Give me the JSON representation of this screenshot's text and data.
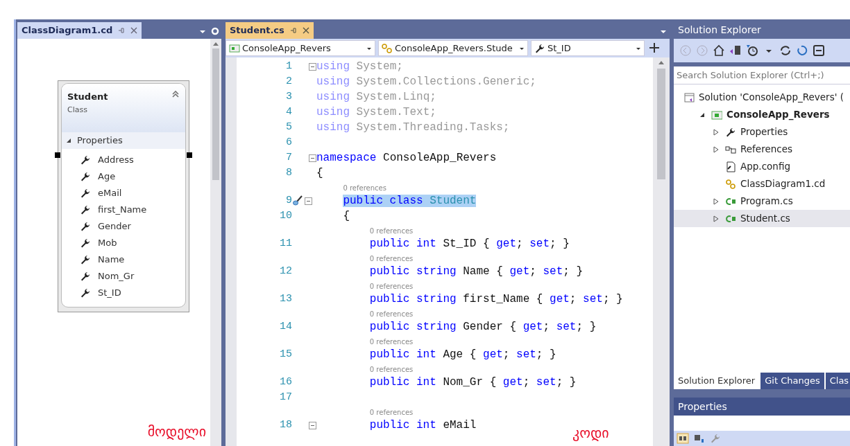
{
  "diagram_panel": {
    "tab": {
      "label": "ClassDiagram1.cd",
      "selected": true
    },
    "class_shape": {
      "name": "Student",
      "kind_label": "Class",
      "selected": true,
      "compartment": {
        "label": "Properties",
        "expanded": true,
        "members": [
          "Address",
          "Age",
          "eMail",
          "first_Name",
          "Gender",
          "Mob",
          "Name",
          "Nom_Gr",
          "St_ID"
        ]
      }
    },
    "annotation": "მოდელი"
  },
  "editor": {
    "tab": {
      "label": "Student.cs",
      "selected": true
    },
    "nav": [
      "ConsoleApp_Revers",
      "ConsoleApp_Revers.Stude",
      "St_ID"
    ],
    "lines": [
      {
        "number": "1",
        "fold": true,
        "highlighted": false,
        "tokens": [
          {
            "t": "using",
            "kind": "dim-keyword"
          },
          {
            "t": " System;",
            "kind": "dim"
          }
        ]
      },
      {
        "number": "2",
        "fold": false,
        "highlighted": false,
        "tokens": [
          {
            "t": "using",
            "kind": "dim-keyword"
          },
          {
            "t": " System.Collections.Generic;",
            "kind": "dim"
          }
        ]
      },
      {
        "number": "3",
        "fold": false,
        "highlighted": false,
        "tokens": [
          {
            "t": "using",
            "kind": "dim-keyword"
          },
          {
            "t": " System.Linq;",
            "kind": "dim"
          }
        ]
      },
      {
        "number": "4",
        "fold": false,
        "highlighted": false,
        "tokens": [
          {
            "t": "using",
            "kind": "dim-keyword"
          },
          {
            "t": " System.Text;",
            "kind": "dim"
          }
        ]
      },
      {
        "number": "5",
        "fold": false,
        "highlighted": false,
        "tokens": [
          {
            "t": "using",
            "kind": "dim-keyword"
          },
          {
            "t": " System.Threading.Tasks;",
            "kind": "dim"
          }
        ]
      },
      {
        "number": "6",
        "fold": false
      },
      {
        "number": "7",
        "fold": true,
        "highlighted": false,
        "tokens": [
          {
            "t": "namespace",
            "kind": "keyword"
          },
          {
            "t": " ConsoleApp_Revers",
            "kind": "plain"
          }
        ]
      },
      {
        "number": "8",
        "fold": false,
        "highlighted": false,
        "tokens": [
          {
            "t": "{",
            "kind": "plain"
          }
        ],
        "children": [
          {
            "number": "9",
            "fold": true,
            "highlighted": true,
            "quick_action": true,
            "references": "0 references",
            "tokens": [
              {
                "t": "public class",
                "kind": "keyword"
              },
              {
                "t": " Student",
                "kind": "type"
              }
            ]
          },
          {
            "number": "10",
            "fold": false,
            "highlighted": false,
            "tokens": [
              {
                "t": "{",
                "kind": "plain"
              }
            ],
            "children": [
              {
                "number": "11",
                "fold": false,
                "highlighted": false,
                "references": "0 references",
                "tokens": [
                  {
                    "t": "public int",
                    "kind": "keyword"
                  },
                  {
                    "t": " St_ID { ",
                    "kind": "plain"
                  },
                  {
                    "t": "get",
                    "kind": "keyword"
                  },
                  {
                    "t": "; ",
                    "kind": "plain"
                  },
                  {
                    "t": "set",
                    "kind": "keyword"
                  },
                  {
                    "t": "; }",
                    "kind": "plain"
                  }
                ]
              },
              {
                "number": "12",
                "fold": false,
                "highlighted": false,
                "references": "0 references",
                "tokens": [
                  {
                    "t": "public string",
                    "kind": "keyword"
                  },
                  {
                    "t": " Name { ",
                    "kind": "plain"
                  },
                  {
                    "t": "get",
                    "kind": "keyword"
                  },
                  {
                    "t": "; ",
                    "kind": "plain"
                  },
                  {
                    "t": "set",
                    "kind": "keyword"
                  },
                  {
                    "t": "; }",
                    "kind": "plain"
                  }
                ]
              },
              {
                "number": "13",
                "fold": false,
                "highlighted": false,
                "references": "0 references",
                "tokens": [
                  {
                    "t": "public string",
                    "kind": "keyword"
                  },
                  {
                    "t": " first_Name { ",
                    "kind": "plain"
                  },
                  {
                    "t": "get",
                    "kind": "keyword"
                  },
                  {
                    "t": "; ",
                    "kind": "plain"
                  },
                  {
                    "t": "set",
                    "kind": "keyword"
                  },
                  {
                    "t": "; }",
                    "kind": "plain"
                  }
                ]
              },
              {
                "number": "14",
                "fold": false,
                "highlighted": false,
                "references": "0 references",
                "tokens": [
                  {
                    "t": "public string",
                    "kind": "keyword"
                  },
                  {
                    "t": " Gender { ",
                    "kind": "plain"
                  },
                  {
                    "t": "get",
                    "kind": "keyword"
                  },
                  {
                    "t": "; ",
                    "kind": "plain"
                  },
                  {
                    "t": "set",
                    "kind": "keyword"
                  },
                  {
                    "t": "; }",
                    "kind": "plain"
                  }
                ]
              },
              {
                "number": "15",
                "fold": false,
                "highlighted": false,
                "references": "0 references",
                "tokens": [
                  {
                    "t": "public int",
                    "kind": "keyword"
                  },
                  {
                    "t": " Age { ",
                    "kind": "plain"
                  },
                  {
                    "t": "get",
                    "kind": "keyword"
                  },
                  {
                    "t": "; ",
                    "kind": "plain"
                  },
                  {
                    "t": "set",
                    "kind": "keyword"
                  },
                  {
                    "t": "; }",
                    "kind": "plain"
                  }
                ]
              },
              {
                "number": "16",
                "fold": false,
                "highlighted": false,
                "references": "0 references",
                "tokens": [
                  {
                    "t": "public int",
                    "kind": "keyword"
                  },
                  {
                    "t": " Nom_Gr { ",
                    "kind": "plain"
                  },
                  {
                    "t": "get",
                    "kind": "keyword"
                  },
                  {
                    "t": "; ",
                    "kind": "plain"
                  },
                  {
                    "t": "set",
                    "kind": "keyword"
                  },
                  {
                    "t": "; }",
                    "kind": "plain"
                  }
                ]
              },
              {
                "number": "17",
                "fold": false
              },
              {
                "number": "18",
                "fold": true,
                "highlighted": false,
                "references": "0 references",
                "tokens": [
                  {
                    "t": "public int",
                    "kind": "keyword"
                  },
                  {
                    "t": " eMail",
                    "kind": "plain"
                  }
                ]
              }
            ]
          }
        ]
      }
    ],
    "annotation": "კოდი"
  },
  "solution_explorer": {
    "title": "Solution Explorer",
    "search": {
      "placeholder": "Search Solution Explorer (Ctrl+;)"
    },
    "tree": [
      {
        "label": "Solution 'ConsoleApp_Revers' (",
        "kind": "solution",
        "selected": false,
        "children": [
          {
            "label": "ConsoleApp_Revers",
            "kind": "project",
            "expanded": true,
            "selected": false,
            "children": [
              {
                "label": "Properties",
                "kind": "properties",
                "expanded": false,
                "selected": false
              },
              {
                "label": "References",
                "kind": "references",
                "expanded": false,
                "selected": false
              },
              {
                "label": "App.config",
                "kind": "config",
                "selected": false
              },
              {
                "label": "ClassDiagram1.cd",
                "kind": "diagram",
                "selected": false
              },
              {
                "label": "Program.cs",
                "kind": "csharp",
                "expanded": false,
                "selected": false
              },
              {
                "label": "Student.cs",
                "kind": "csharp",
                "expanded": false,
                "selected": true
              }
            ]
          }
        ]
      }
    ],
    "bottom_tabs": [
      {
        "label": "Solution Explorer",
        "selected": true
      },
      {
        "label": "Git Changes",
        "selected": false
      },
      {
        "label": "Clas",
        "selected": false
      }
    ]
  },
  "properties_panel": {
    "title": "Properties"
  }
}
